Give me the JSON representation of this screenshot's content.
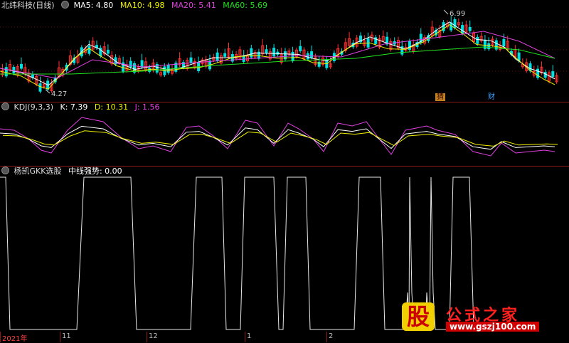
{
  "main": {
    "title": "北纬科技(日线)",
    "ma5": "MA5: 4.80",
    "ma10": "MA10: 4.98",
    "ma20": "MA20: 5.41",
    "ma60": "MA60: 5.69",
    "high_label": "6.99",
    "low_label": "4.27",
    "badge1": "猜",
    "badge2": "财",
    "colors": {
      "ma5": "#ffffff",
      "ma10": "#f0f000",
      "ma20": "#e040e0",
      "ma60": "#20e020",
      "up": "#ff3030",
      "down": "#00e0e0"
    }
  },
  "kdj": {
    "name": "KDJ(9,3,3)",
    "k": "K: 7.39",
    "d": "D: 10.31",
    "j": "J: 1.56",
    "colors": {
      "k": "#ffffff",
      "d": "#f0f000",
      "j": "#e040e0"
    }
  },
  "ind": {
    "name": "杨凯GKK选股",
    "trend": "中线强势: 0.00"
  },
  "axis": {
    "labels": [
      "2021年",
      "11",
      "12",
      "1",
      "2"
    ]
  },
  "logo": {
    "gu": "股",
    "name": "公式之家",
    "url": "www.gszj100.com"
  }
}
